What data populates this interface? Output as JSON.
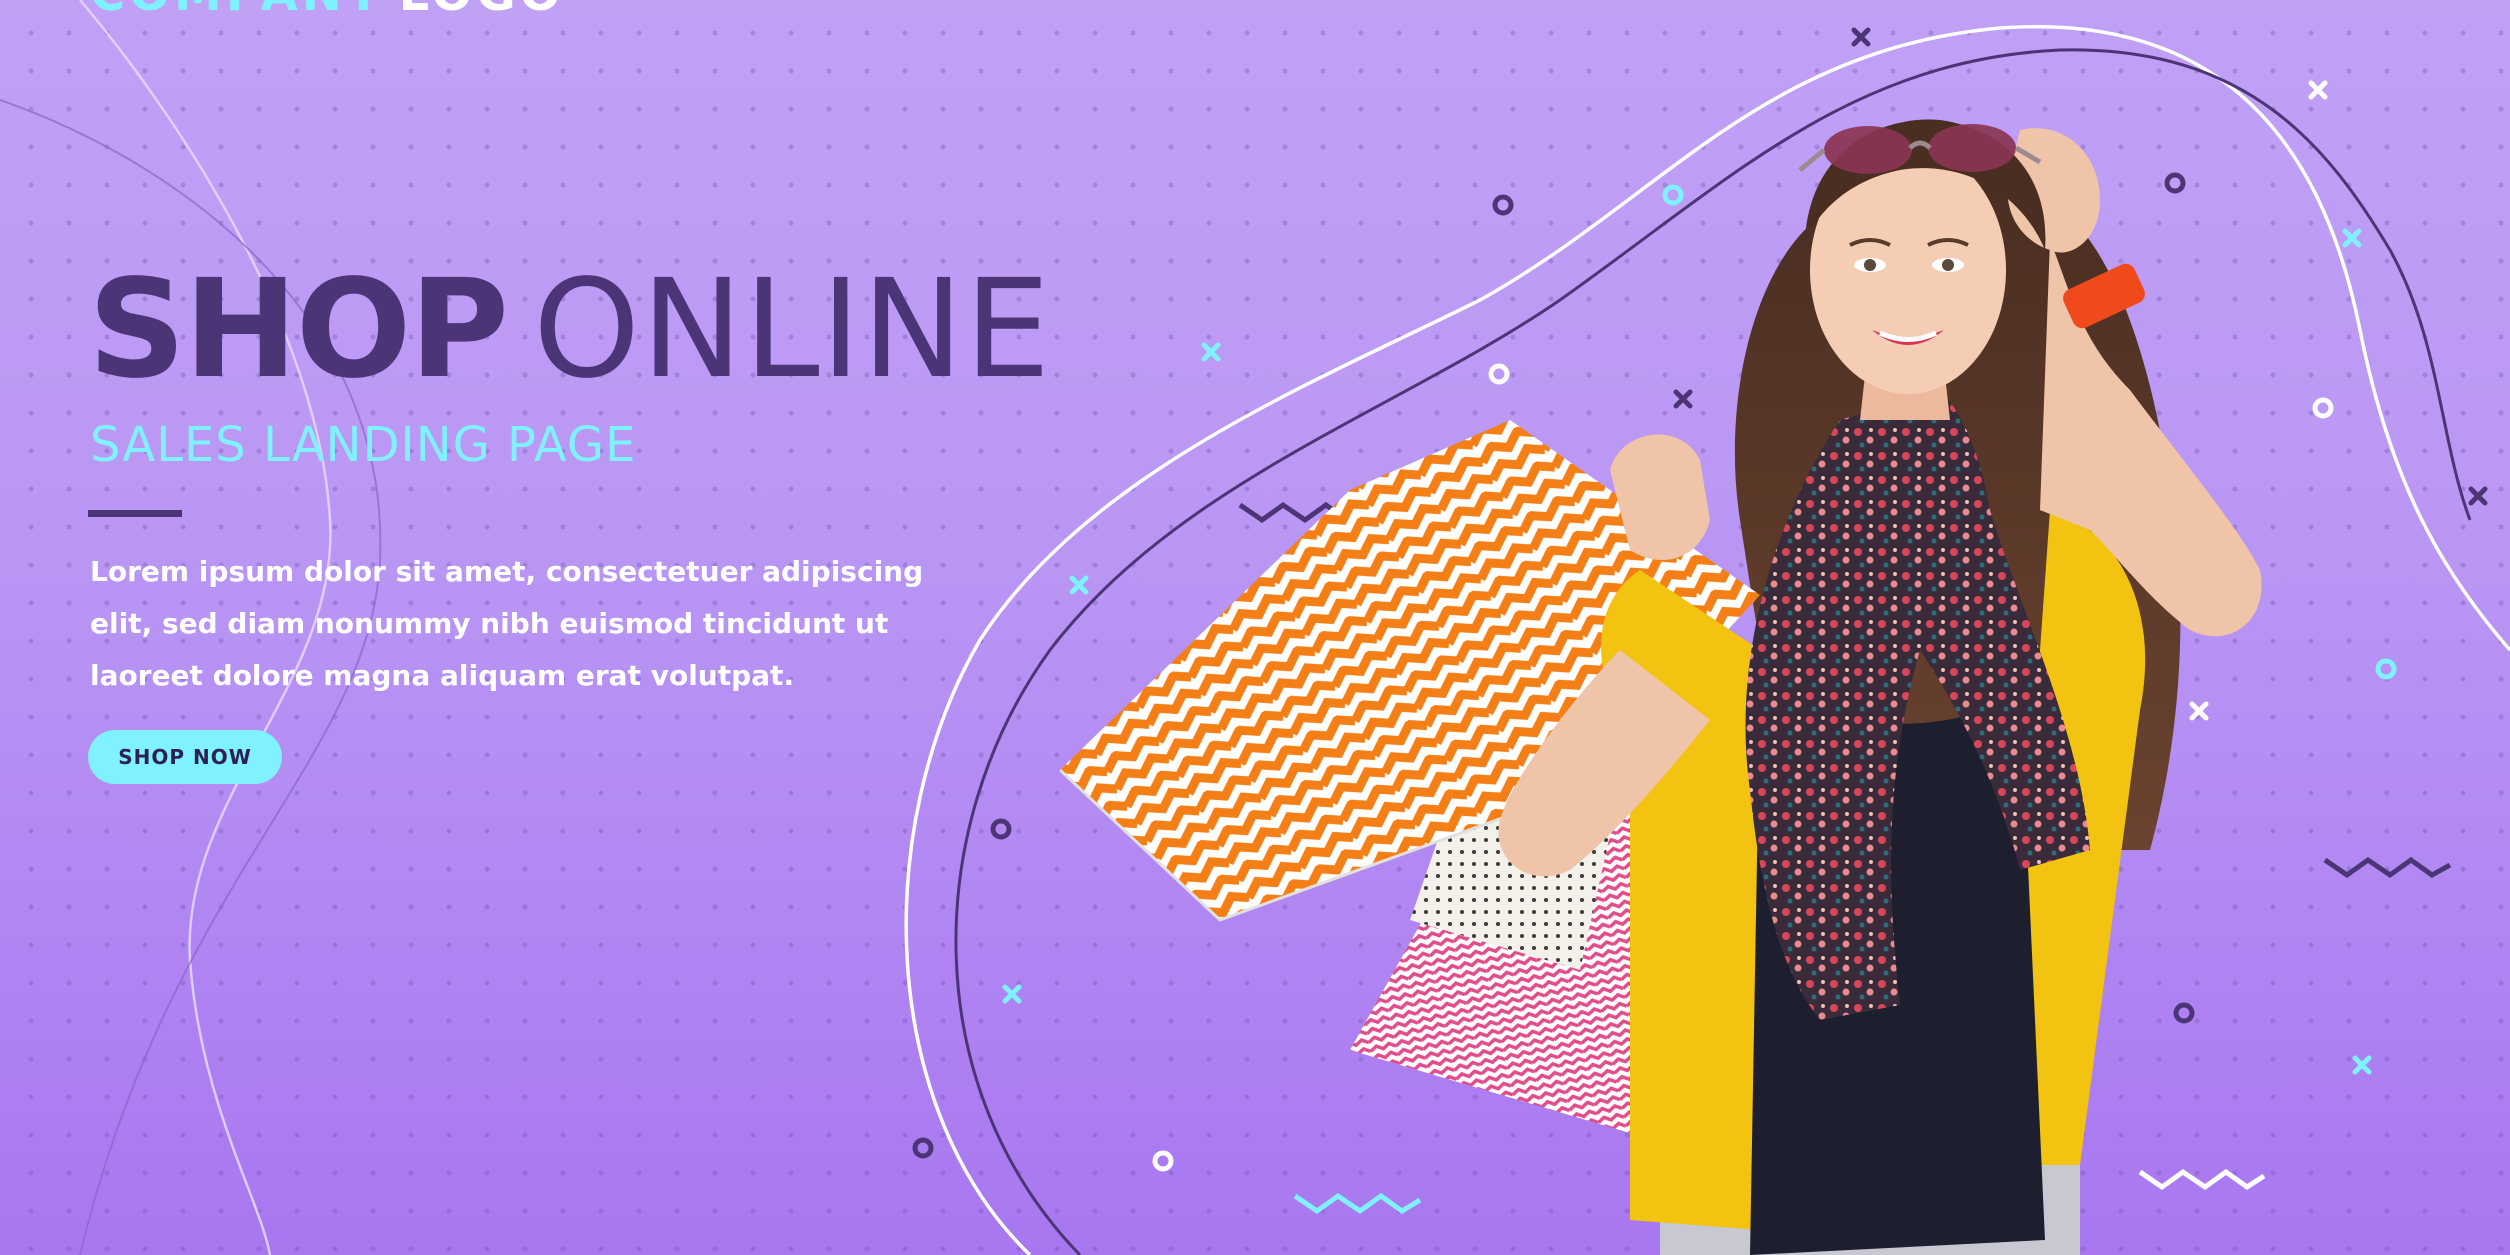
{
  "logo": {
    "part1": "COMPANY",
    "part2": "LOGO"
  },
  "hero": {
    "title_bold": "SHOP",
    "title_light": "ONLINE",
    "subtitle": "SALES LANDING PAGE",
    "description_lines": [
      "Lorem ipsum dolor sit amet, consectetuer adipiscing",
      "elit, sed diam nonummy nibh euismod tincidunt ut",
      "laoreet dolore magna aliquam erat volutpat."
    ],
    "cta_label": "SHOP NOW"
  },
  "colors": {
    "background_top": "#c0a1f6",
    "background_bottom": "#a877f0",
    "title": "#4b3577",
    "accent_cyan": "#7ff1ff",
    "text_white": "#ffffff"
  },
  "image": {
    "subject": "smiling-woman-with-shopping-bags"
  }
}
